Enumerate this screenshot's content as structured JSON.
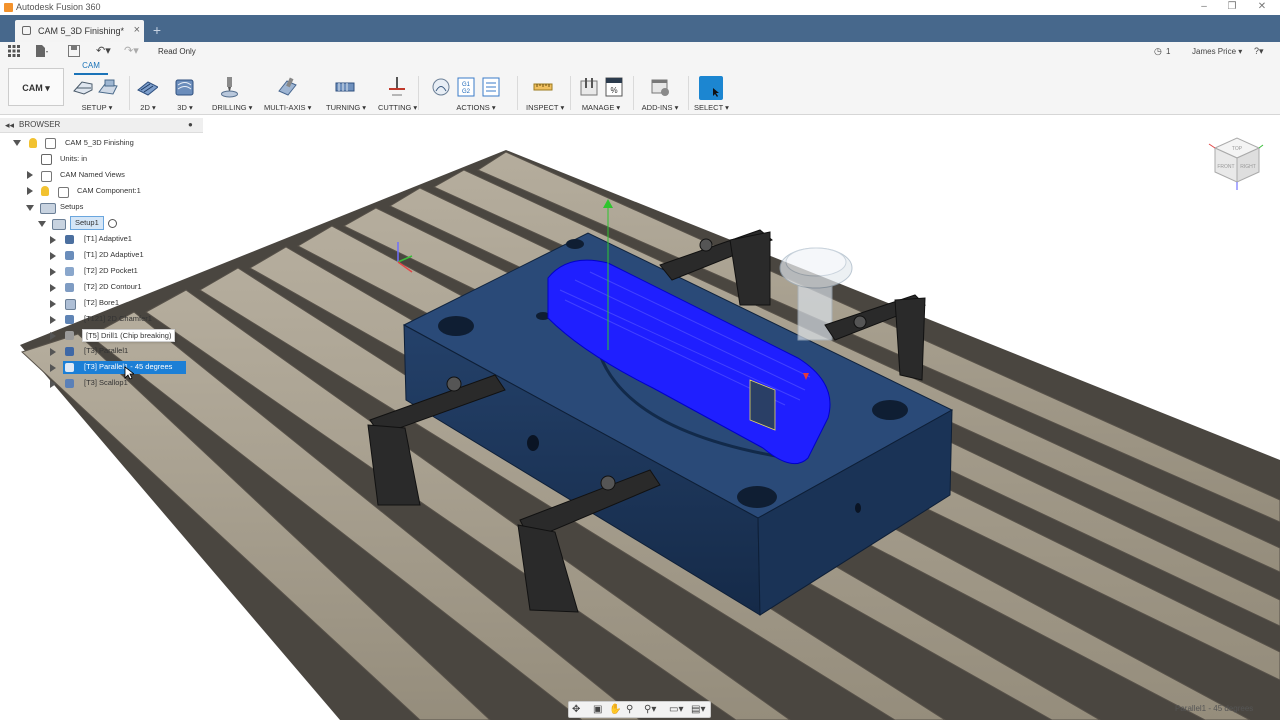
{
  "app": {
    "title": "Autodesk Fusion 360"
  },
  "tab": {
    "label": "CAM 5_3D Finishing*",
    "close": "×",
    "new": "+"
  },
  "quickbar": {
    "read_only": "Read Only",
    "jobs_count": "1",
    "user": "James Price ▾",
    "help": "?▾"
  },
  "ribbon": {
    "workspace": "CAM ▾",
    "tab": "CAM",
    "groups": [
      {
        "label": "SETUP ▾"
      },
      {
        "label": "2D ▾"
      },
      {
        "label": "3D ▾"
      },
      {
        "label": "DRILLING ▾"
      },
      {
        "label": "MULTI-AXIS ▾"
      },
      {
        "label": "TURNING ▾"
      },
      {
        "label": "CUTTING ▾"
      },
      {
        "label": "ACTIONS ▾"
      },
      {
        "label": "INSPECT ▾"
      },
      {
        "label": "MANAGE ▾"
      },
      {
        "label": "ADD-INS ▾"
      },
      {
        "label": "SELECT ▾"
      }
    ],
    "g1g2_text": "G1\nG2",
    "percent_text": "%"
  },
  "browser": {
    "title": "BROWSER",
    "items": [
      {
        "label": "CAM 5_3D Finishing"
      },
      {
        "label": "Units: in"
      },
      {
        "label": "CAM Named Views"
      },
      {
        "label": "CAM Component:1"
      },
      {
        "label": "Setups"
      },
      {
        "label": "Setup1"
      },
      {
        "label": "[T1] Adaptive1"
      },
      {
        "label": "[T1] 2D Adaptive1"
      },
      {
        "label": "[T2] 2D Pocket1"
      },
      {
        "label": "[T2] 2D Contour1"
      },
      {
        "label": "[T2] Bore1"
      },
      {
        "label": "[T121] 2D Chamfer1"
      },
      {
        "label": "[T5] Drill1 (Chip breaking)"
      },
      {
        "label": "[T3] Parallel1"
      },
      {
        "label": "[T3] Parallel1 - 45 degrees"
      },
      {
        "label": "[T3] Scallop1"
      }
    ]
  },
  "viewcube": {
    "top": "TOP",
    "front": "FRONT",
    "right": "RIGHT"
  },
  "status": {
    "text": "Parallel1 - 45 degrees"
  },
  "colors": {
    "accent": "#1a73b8",
    "tabbar": "#47688c",
    "toolpath": "#1f1fff",
    "fixture": "#1f3557"
  }
}
